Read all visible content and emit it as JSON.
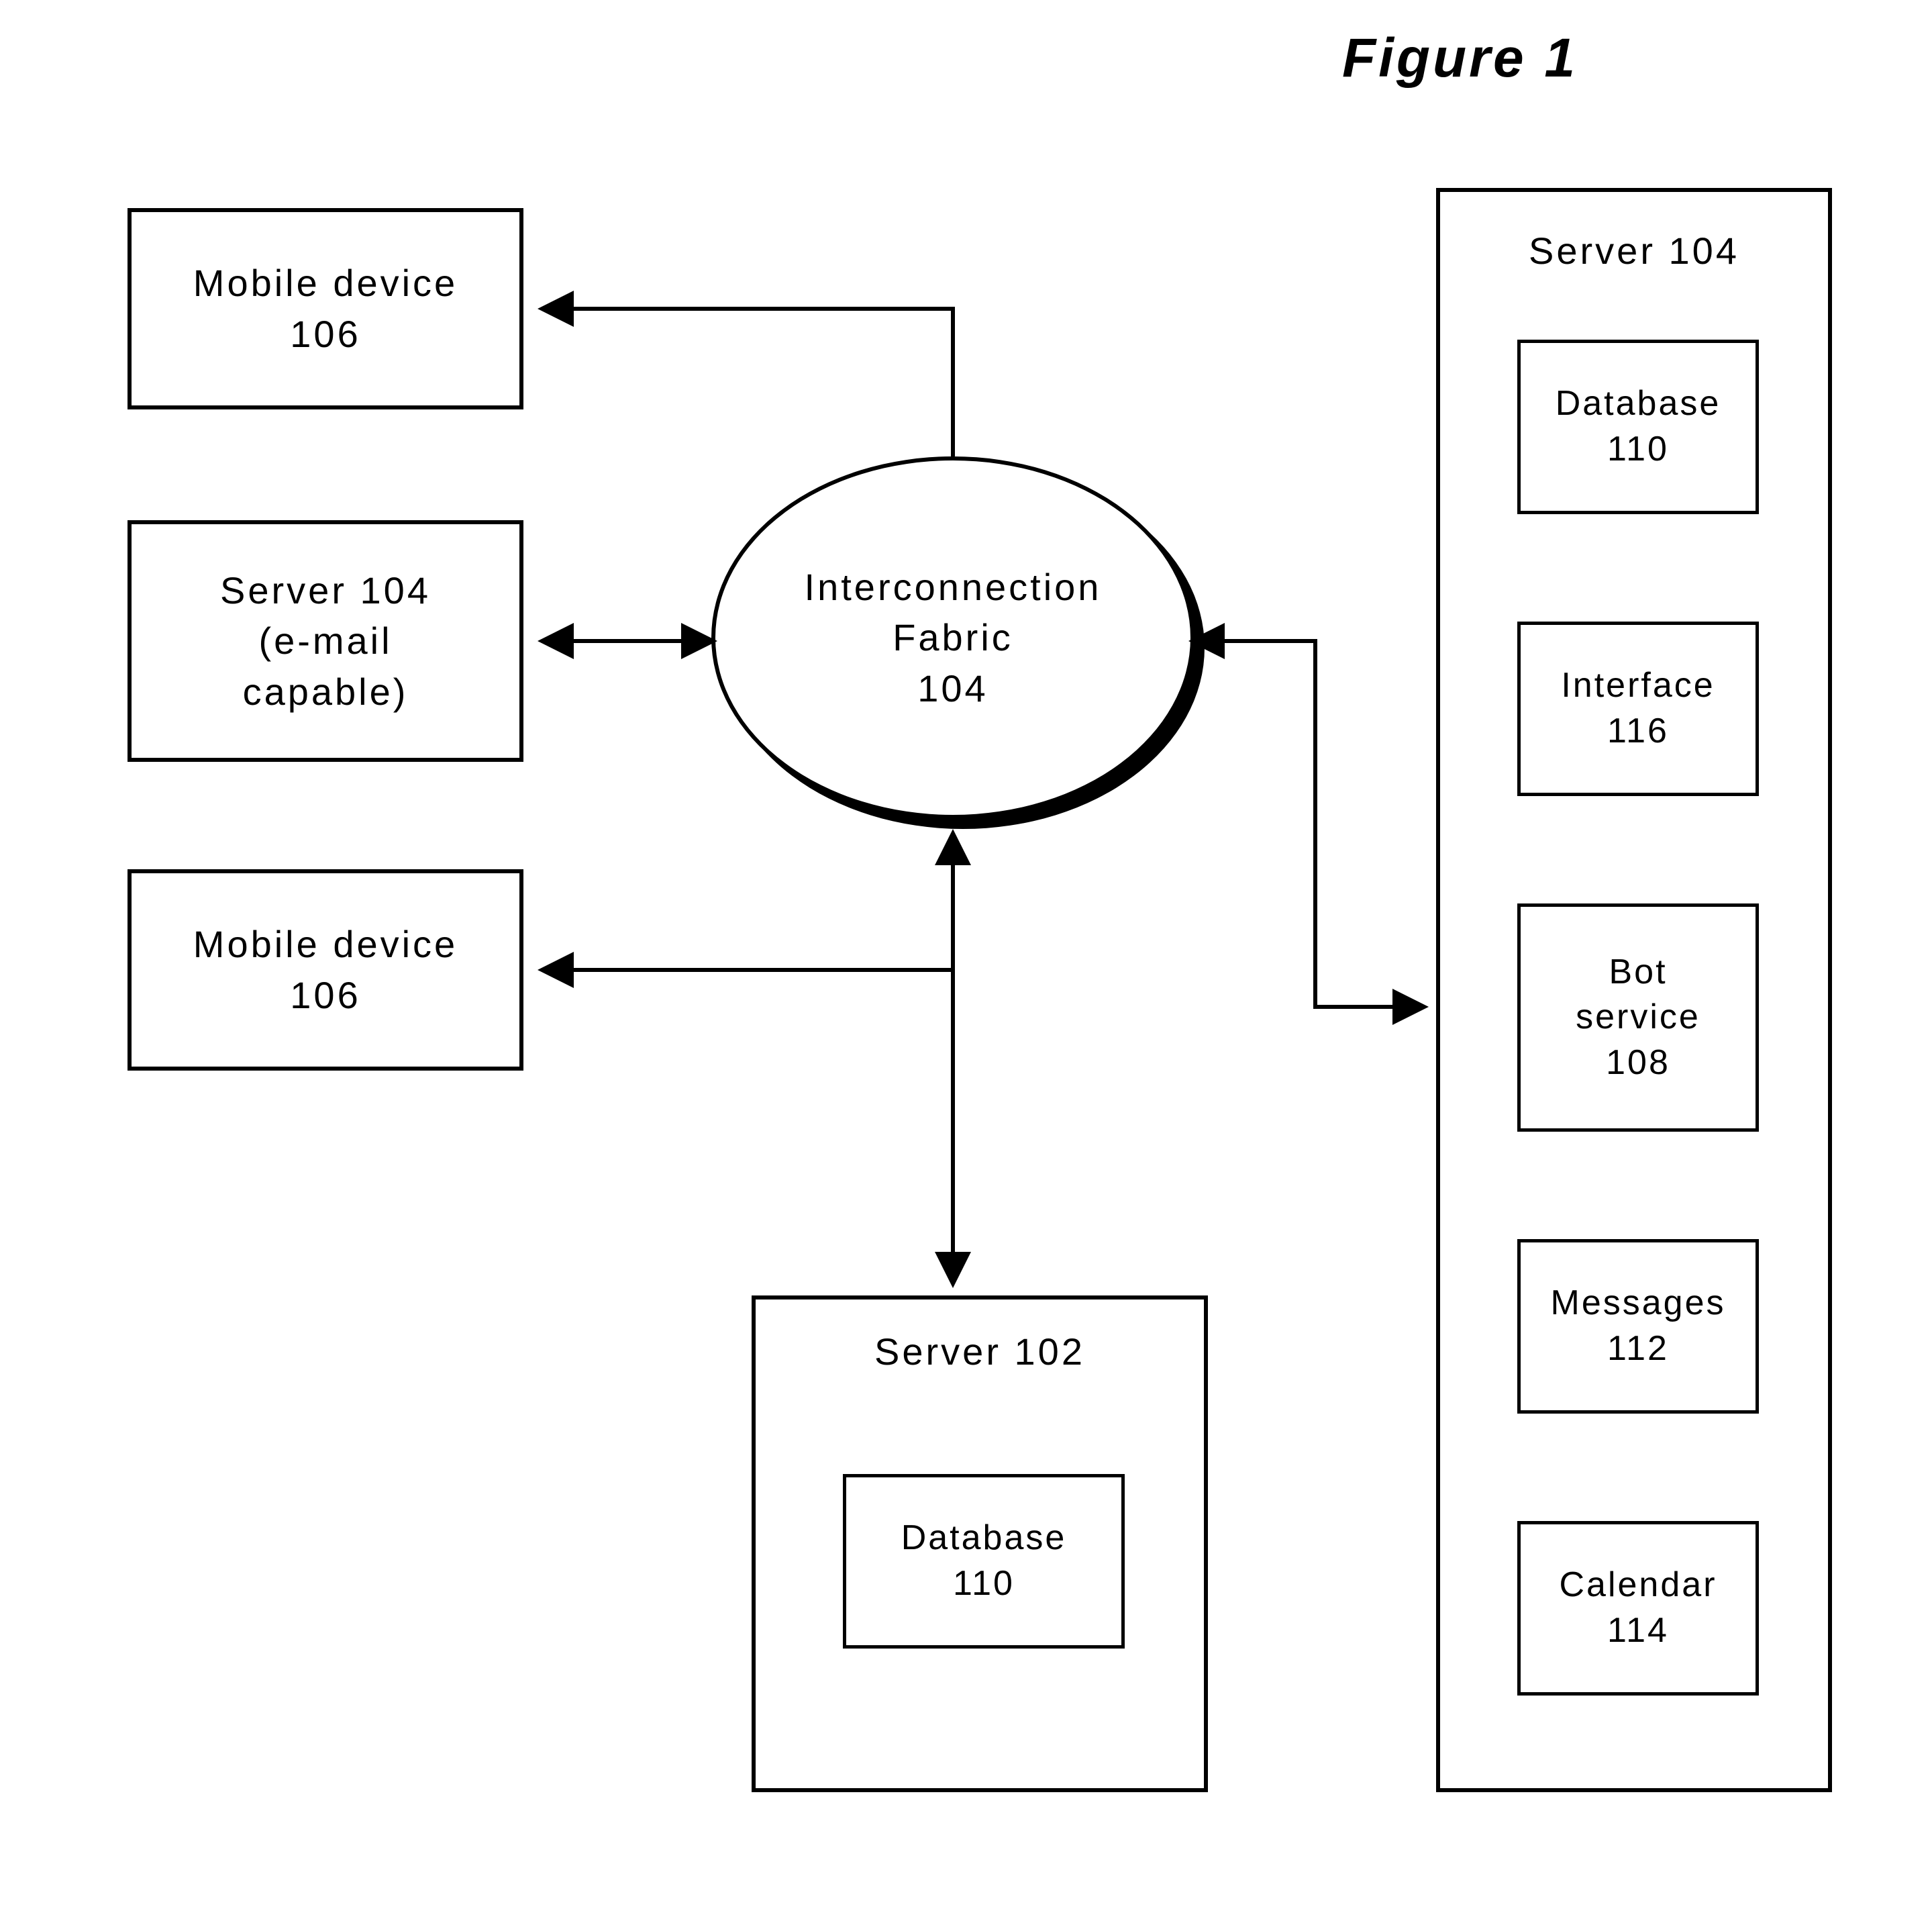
{
  "figure_title": "Figure  1",
  "hub": {
    "label": "Interconnection\nFabric\n104"
  },
  "left_boxes": {
    "mobile1": "Mobile  device\n106",
    "server_email": "Server  104\n(e-mail\ncapable)",
    "mobile2": "Mobile  device\n106"
  },
  "bottom_server": {
    "title": "Server  102",
    "db": "Database\n110"
  },
  "right_server": {
    "title": "Server  104",
    "items": {
      "database": "Database\n110",
      "interface": "Interface\n116",
      "bot": "Bot\nservice\n108",
      "messages": "Messages\n112",
      "calendar": "Calendar\n114"
    }
  }
}
